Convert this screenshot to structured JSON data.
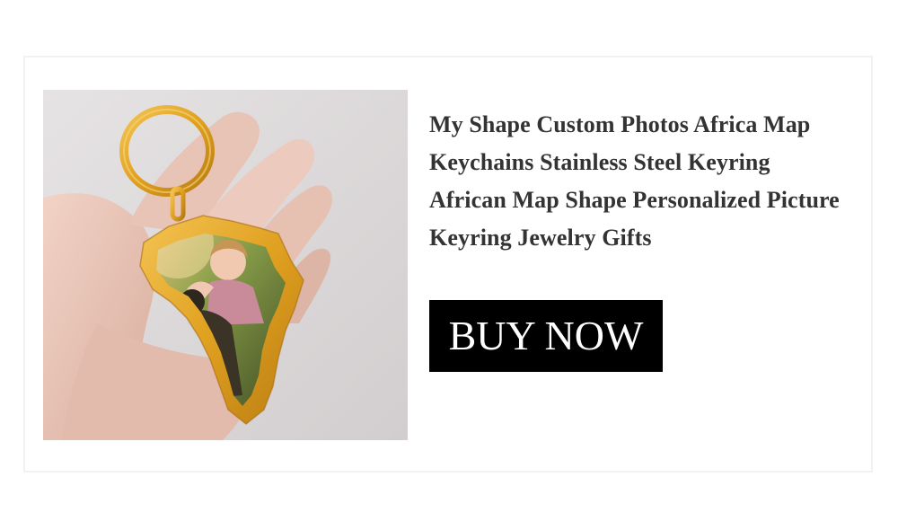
{
  "product": {
    "title": "My Shape Custom Photos Africa Map Keychains Stainless Steel Keyring African Map Shape Personalized Picture Keyring Jewelry Gifts",
    "image_icon": "africa-map-keychain-photo-icon",
    "buy_label": "BUY NOW"
  },
  "colors": {
    "title_text": "#333333",
    "button_background": "#000000",
    "button_text": "#ffffff",
    "card_border": "#f1f1f1",
    "gold": "#e0a020",
    "image_background": "#dcd9da"
  }
}
